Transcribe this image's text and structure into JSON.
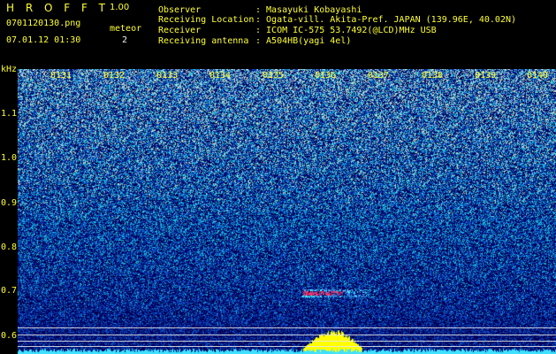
{
  "app": {
    "title": "H R O F F T",
    "version": "1.00"
  },
  "file": {
    "name": "0701120130.png",
    "datetime": "07.01.12 01:30"
  },
  "event": {
    "label": "meteor",
    "count": "2"
  },
  "info": {
    "observer_label": "Observer",
    "observer_value": ": Masayuki Kobayashi",
    "location_label": "Receiving Location",
    "location_value": ": Ogata-vill. Akita-Pref. JAPAN (139.96E, 40.02N)",
    "receiver_label": "Receiver",
    "receiver_value": ": ICOM IC-575 53.7492(@LCD)MHz USB",
    "antenna_label": "Receiving antenna",
    "antenna_value": ": A504HB(yagi 4el)"
  },
  "spectrogram": {
    "unit_label": "kHz",
    "time_ticks": [
      "0131",
      "0132",
      "0133",
      "0134",
      "0135",
      "0136",
      "0137",
      "0138",
      "0139",
      "0140"
    ],
    "freq_ticks": [
      "1.1",
      "1.0",
      "0.9",
      "0.8",
      "0.7",
      "0.6"
    ],
    "colors": {
      "background": "#000000",
      "noise_low": "#0a1a8c",
      "noise_mid": "#2a6acc",
      "noise_high": "#7ad8d0",
      "signal_hot": "#ff3060",
      "burst_yellow": "#ffff00",
      "baseline_cyan": "#40e0ff",
      "label_yellow": "#ffff33"
    }
  }
}
